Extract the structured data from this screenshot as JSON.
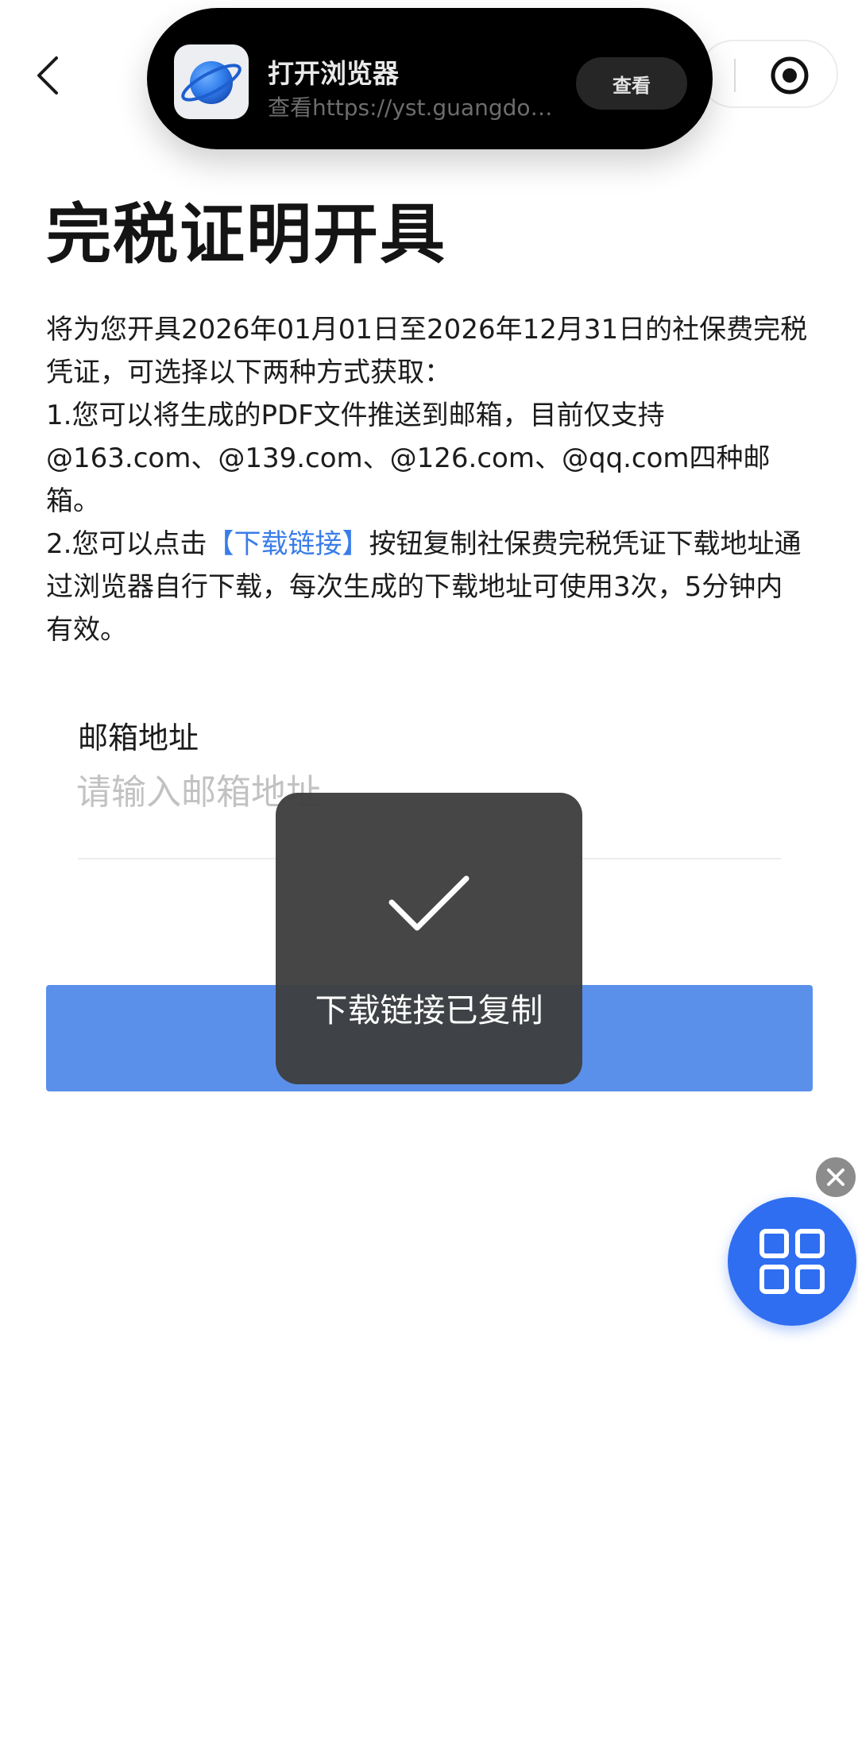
{
  "colors": {
    "accent": "#3a7de8",
    "primary_button": "#5a90ea",
    "fab": "#2f6ef0",
    "toast_bg": "#3e3e3e",
    "banner_bg": "#000000"
  },
  "nav": {
    "back_icon": "chevron-left-icon",
    "record_icon": "record-target-icon"
  },
  "banner": {
    "icon": "browser-planet-icon",
    "title": "打开浏览器",
    "subtitle": "查看https://yst.guangdong.gov.cn",
    "view_label": "查看"
  },
  "page": {
    "title": "完税证明开具"
  },
  "description": {
    "intro": "将为您开具2026年01月01日至2026年12月31日的社保费完税凭证，可选择以下两种方式获取：",
    "item1": "1.您可以将生成的PDF文件推送到邮箱，目前仅支持@163.com、@139.com、@126.com、@qq.com四种邮箱。",
    "item2_prefix": "2.您可以点击",
    "item2_link": "【下载链接】",
    "item2_suffix": "按钮复制社保费完税凭证下载地址通过浏览器自行下载，每次生成的下载地址可使用3次，5分钟内有效。"
  },
  "email": {
    "label": "邮箱地址",
    "placeholder": "请输入邮箱地址",
    "value": ""
  },
  "toast": {
    "icon": "checkmark-icon",
    "text": "下载链接已复制"
  },
  "fab": {
    "icon": "grid-apps-icon",
    "close_icon": "close-icon"
  }
}
